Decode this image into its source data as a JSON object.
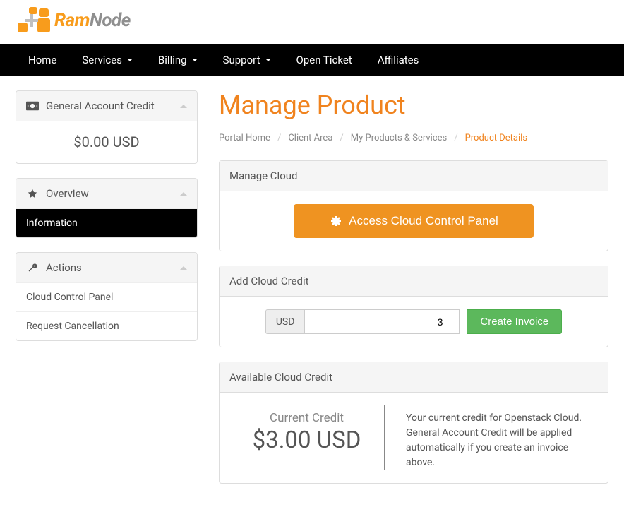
{
  "logo": {
    "ram": "Ram",
    "node": "Node"
  },
  "nav": {
    "home": "Home",
    "services": "Services",
    "billing": "Billing",
    "support": "Support",
    "open_ticket": "Open Ticket",
    "affiliates": "Affiliates"
  },
  "sidebar": {
    "credit": {
      "title": "General Account Credit",
      "amount": "$0.00 USD"
    },
    "overview": {
      "title": "Overview",
      "information": "Information"
    },
    "actions": {
      "title": "Actions",
      "ccp": "Cloud Control Panel",
      "cancel": "Request Cancellation"
    }
  },
  "page": {
    "title": "Manage Product",
    "breadcrumb": {
      "portal": "Portal Home",
      "client": "Client Area",
      "products": "My Products & Services",
      "current": "Product Details"
    }
  },
  "manage_cloud": {
    "title": "Manage Cloud",
    "button": "Access Cloud Control Panel"
  },
  "add_credit": {
    "title": "Add Cloud Credit",
    "currency": "USD",
    "value": "3",
    "button": "Create Invoice"
  },
  "available_credit": {
    "title": "Available Cloud Credit",
    "label": "Current Credit",
    "amount": "$3.00 USD",
    "desc": "Your current credit for Openstack Cloud. General Account Credit will be applied automatically if you create an invoice above."
  }
}
